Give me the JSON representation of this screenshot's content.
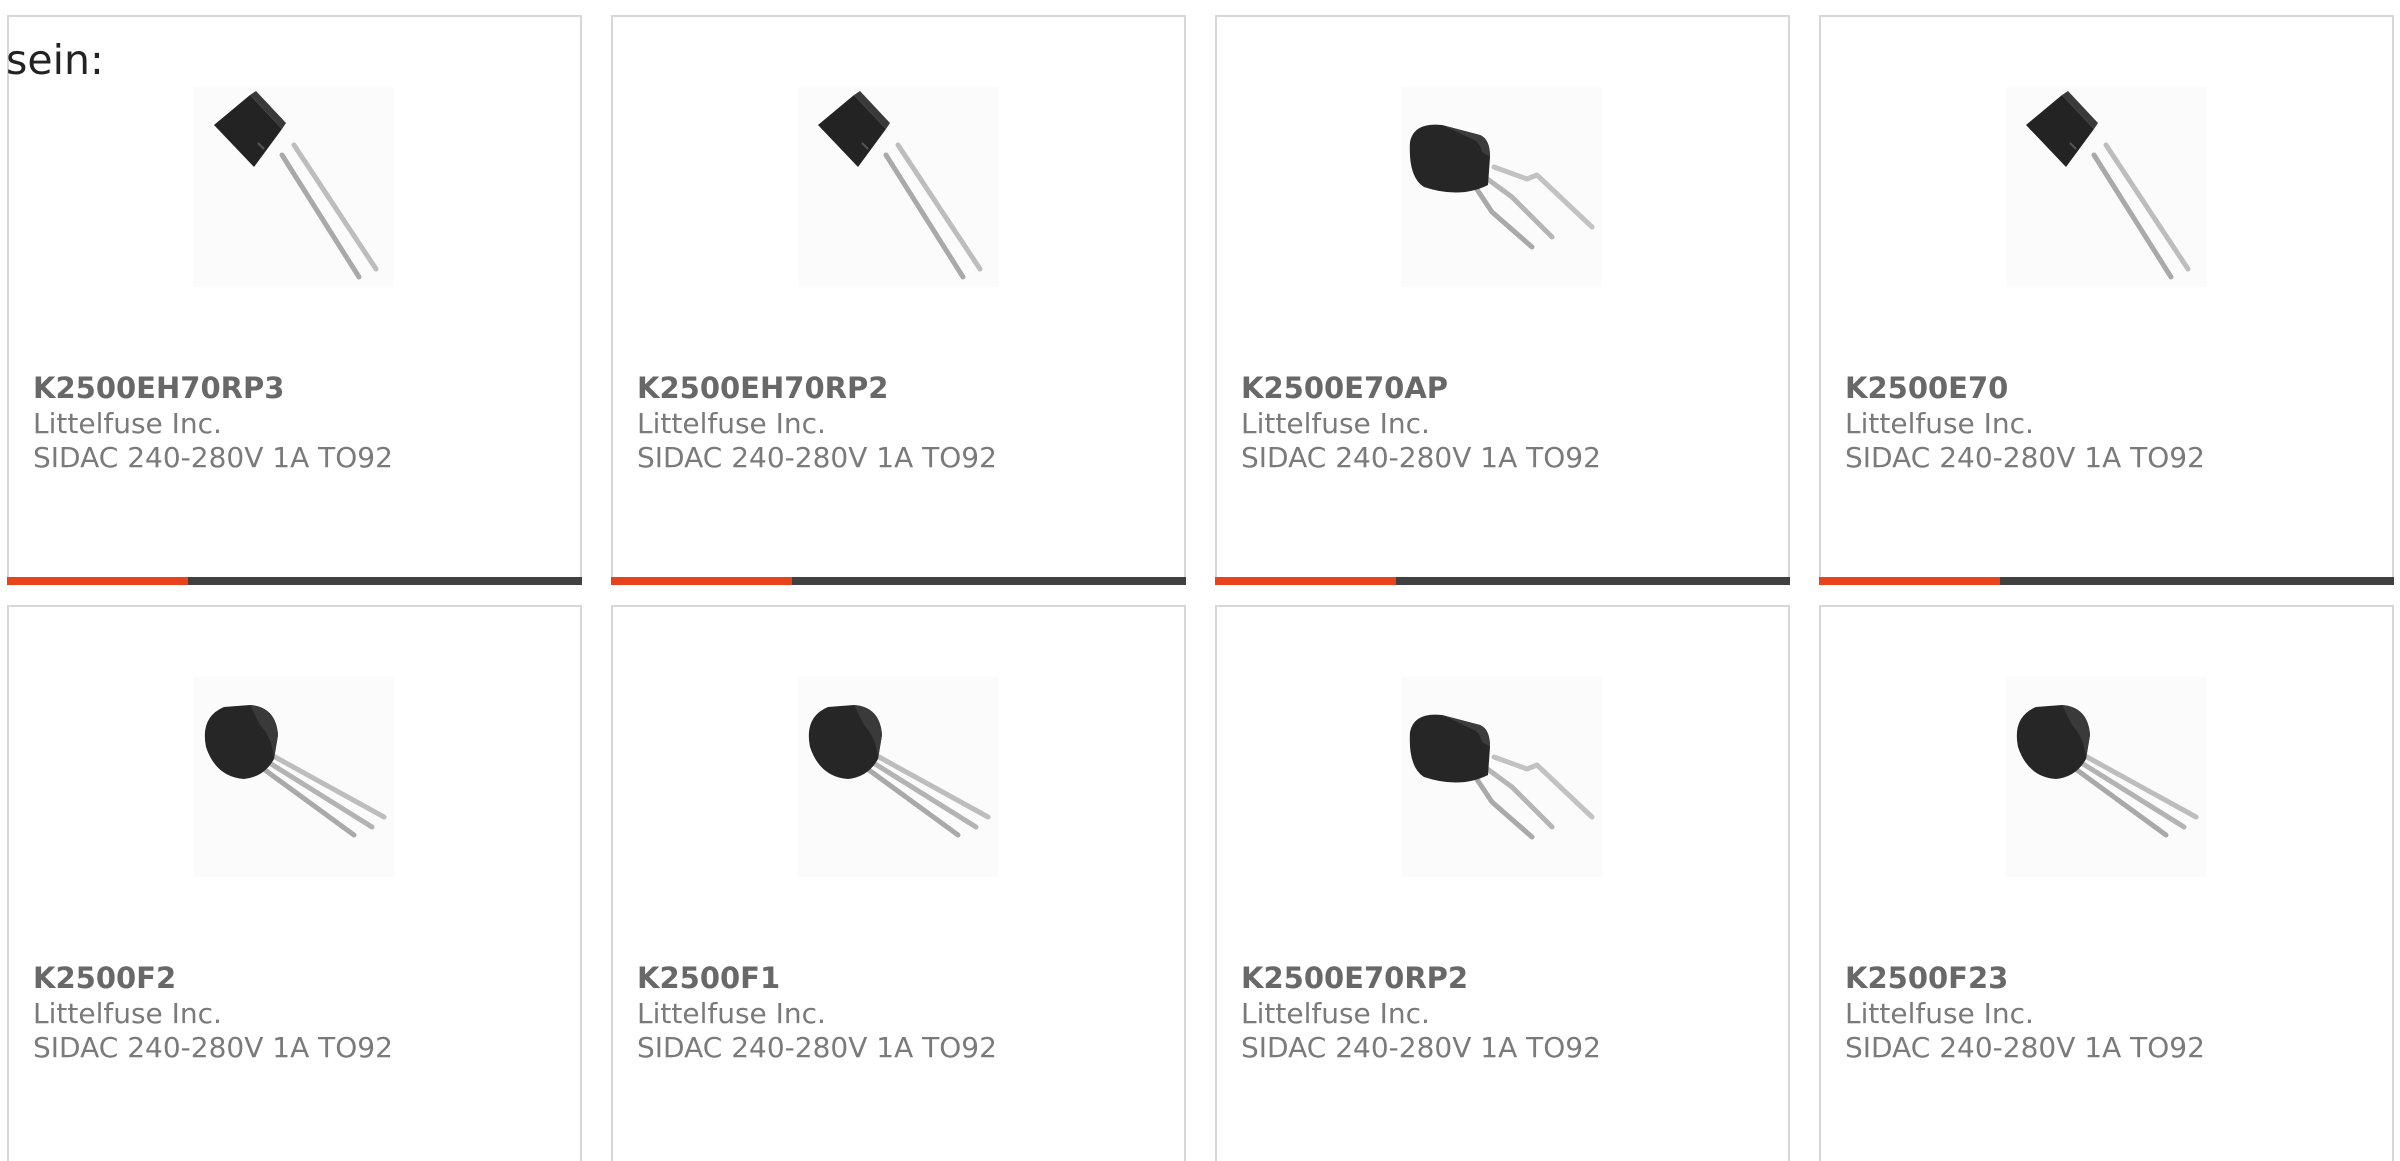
{
  "intro_text": "sein:",
  "accent_color": "#e8431c",
  "bar_color": "#404040",
  "cards": [
    {
      "part_number": "K2500EH70RP3",
      "manufacturer": "Littelfuse Inc.",
      "description": "SIDAC 240-280V 1A TO92",
      "image": "to92-straight-leads-icon",
      "progress": 0.315
    },
    {
      "part_number": "K2500EH70RP2",
      "manufacturer": "Littelfuse Inc.",
      "description": "SIDAC 240-280V 1A TO92",
      "image": "to92-straight-leads-icon",
      "progress": 0.315
    },
    {
      "part_number": "K2500E70AP",
      "manufacturer": "Littelfuse Inc.",
      "description": "SIDAC 240-280V 1A TO92",
      "image": "to92-formed-leads-icon",
      "progress": 0.315
    },
    {
      "part_number": "K2500E70",
      "manufacturer": "Littelfuse Inc.",
      "description": "SIDAC 240-280V 1A TO92",
      "image": "to92-straight-leads-icon",
      "progress": 0.315
    },
    {
      "part_number": "K2500F2",
      "manufacturer": "Littelfuse Inc.",
      "description": "SIDAC 240-280V 1A TO92",
      "image": "to92-round-body-icon"
    },
    {
      "part_number": "K2500F1",
      "manufacturer": "Littelfuse Inc.",
      "description": "SIDAC 240-280V 1A TO92",
      "image": "to92-round-body-icon"
    },
    {
      "part_number": "K2500E70RP2",
      "manufacturer": "Littelfuse Inc.",
      "description": "SIDAC 240-280V 1A TO92",
      "image": "to92-formed-leads-icon"
    },
    {
      "part_number": "K2500F23",
      "manufacturer": "Littelfuse Inc.",
      "description": "SIDAC 240-280V 1A TO92",
      "image": "to92-round-body-icon"
    }
  ]
}
